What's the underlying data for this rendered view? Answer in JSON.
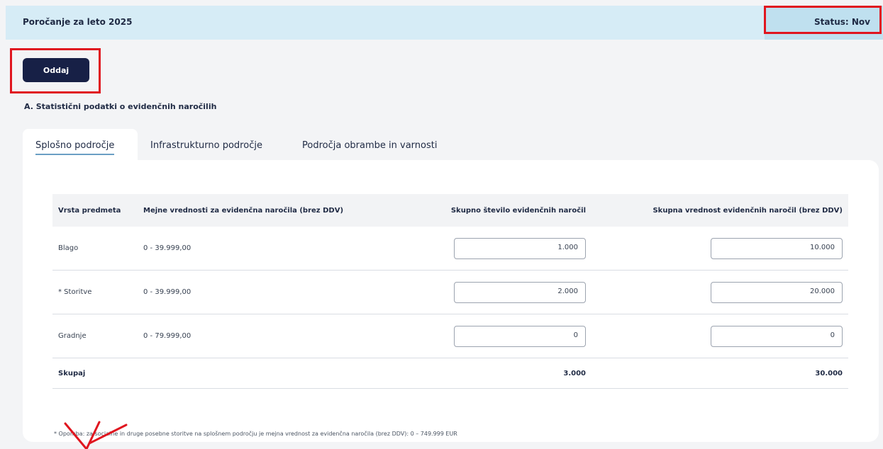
{
  "header": {
    "title": "Poročanje za leto 2025",
    "status": "Status: Nov"
  },
  "submit_label": "Oddaj",
  "section_title": "A. Statistični podatki o evidenčnih naročilih",
  "tabs": [
    {
      "label": "Splošno področje"
    },
    {
      "label": "Infrastrukturno področje"
    },
    {
      "label": "Področja obrambe in varnosti"
    }
  ],
  "table": {
    "headers": [
      "Vrsta predmeta",
      "Mejne vrednosti za evidenčna naročila (brez DDV)",
      "Skupno število evidenčnih naročil",
      "Skupna vrednost evidenčnih naročil (brez DDV)"
    ],
    "rows": [
      {
        "type": "Blago",
        "limits": "0 - 39.999,00",
        "count": "1.000",
        "value": "10.000"
      },
      {
        "type": "* Storitve",
        "limits": "0 - 39.999,00",
        "count": "2.000",
        "value": "20.000"
      },
      {
        "type": "Gradnje",
        "limits": "0 - 79.999,00",
        "count": "0",
        "value": "0"
      }
    ],
    "total": {
      "label": "Skupaj",
      "count": "3.000",
      "value": "30.000"
    }
  },
  "note": "* Opomba: za socialne in druge posebne storitve na splošnem področju je mejna vrednost za evidenčna naročila (brez DDV): 0 – 749.999 EUR",
  "colors": {
    "highlight": "#e0161f",
    "button": "#172046",
    "header_bg": "#d6ecf6"
  }
}
